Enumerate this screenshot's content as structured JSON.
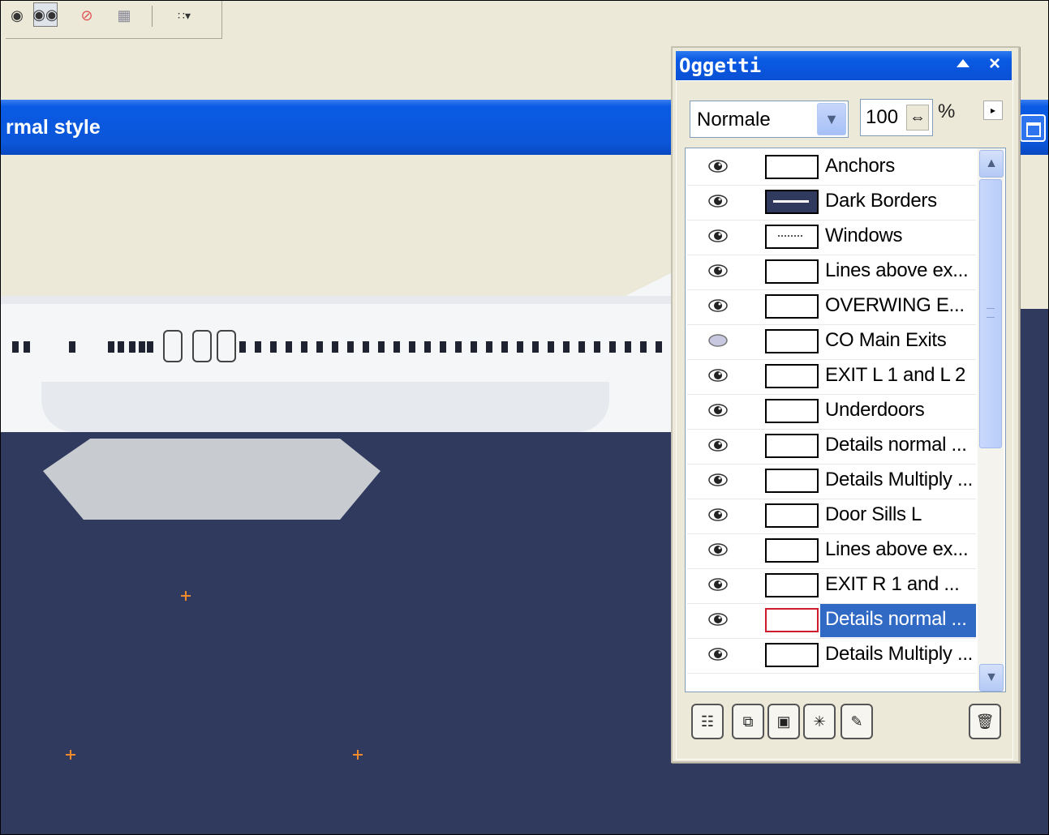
{
  "toolbar": {
    "tools": [
      {
        "icon": "eye-icon",
        "pressed": false
      },
      {
        "icon": "eye-pair-icon",
        "pressed": true
      },
      {
        "icon": "no-preview-icon",
        "pressed": false
      },
      {
        "icon": "image-icon",
        "pressed": false
      },
      {
        "icon": "dropdown-tool-icon",
        "pressed": false
      }
    ]
  },
  "document": {
    "title": "rmal style"
  },
  "panel": {
    "title": "Oggetti",
    "blend_mode": "Normale",
    "opacity": "100",
    "opacity_unit": "%",
    "layers": [
      {
        "name": "Anchors",
        "visible": true,
        "thumb": "empty"
      },
      {
        "name": "Dark Borders",
        "visible": true,
        "thumb": "dark"
      },
      {
        "name": "Windows",
        "visible": true,
        "thumb": "dots"
      },
      {
        "name": "Lines above ex...",
        "visible": true,
        "thumb": "empty"
      },
      {
        "name": "OVERWING E...",
        "visible": true,
        "thumb": "empty"
      },
      {
        "name": "CO Main Exits",
        "visible": false,
        "thumb": "empty"
      },
      {
        "name": "EXIT L 1 and L 2",
        "visible": true,
        "thumb": "empty"
      },
      {
        "name": "Underdoors",
        "visible": true,
        "thumb": "empty"
      },
      {
        "name": "Details normal ...",
        "visible": true,
        "thumb": "empty"
      },
      {
        "name": "Details Multiply ...",
        "visible": true,
        "thumb": "empty"
      },
      {
        "name": "Door Sills L",
        "visible": true,
        "thumb": "empty"
      },
      {
        "name": "Lines above ex...",
        "visible": true,
        "thumb": "empty"
      },
      {
        "name": "EXIT R 1 and ...",
        "visible": true,
        "thumb": "empty"
      },
      {
        "name": "Details normal ...",
        "visible": true,
        "thumb": "selected",
        "selected": true
      },
      {
        "name": "Details Multiply ...",
        "visible": true,
        "thumb": "empty"
      }
    ],
    "bottom_buttons": [
      "new-layer-icon",
      "duplicate-layer-icon",
      "merge-layer-icon",
      "layer-effects-icon",
      "layer-properties-icon",
      "trash-icon"
    ]
  },
  "colors": {
    "canvas": "#2f3a5e",
    "xp_blue": "#0a5ae4",
    "selection": "#316ac5",
    "marker": "#f08a2a"
  }
}
